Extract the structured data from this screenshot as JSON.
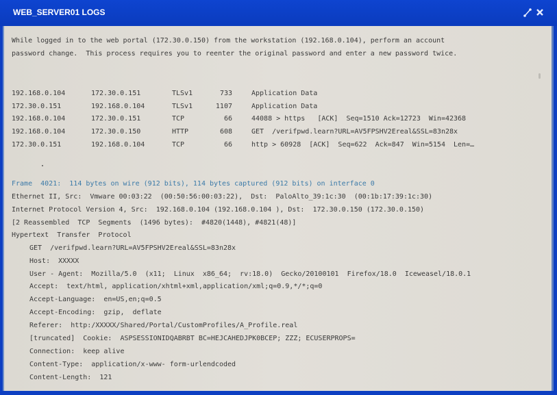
{
  "window": {
    "title": "WEB_SERVER01 LOGS",
    "resize_icon": "resize-icon",
    "close_icon": "close-icon"
  },
  "intro": {
    "line1": "While logged in to the web portal (172.30.0.150) from the workstation (192.168.0.104), perform an account",
    "line2": "password change.  This process requires you to reenter the original password and enter a new password twice."
  },
  "packets": [
    {
      "src": "192.168.0.104",
      "dst": "172.30.0.151",
      "proto": "TLSv1",
      "len": "733",
      "info": "Application Data"
    },
    {
      "src": "172.30.0.151",
      "dst": "192.168.0.104",
      "proto": "TLSv1",
      "len": "1107",
      "info": "Application Data"
    },
    {
      "src": "192.168.0.104",
      "dst": "172.30.0.151",
      "proto": "TCP",
      "len": "66",
      "info": "44088 > https   [ACK]  Seq=1510 Ack=12723  Win=42368"
    },
    {
      "src": "192.168.0.104",
      "dst": "172.30.0.150",
      "proto": "HTTP",
      "len": "608",
      "info": "GET  /verifpwd.learn?URL=AV5FPSHV2Ereal&SSL=83n28x"
    },
    {
      "src": "172.30.0.151",
      "dst": "192.168.0.104",
      "proto": "TCP",
      "len": "66",
      "info": "http > 60928  [ACK]  Seq=622  Ack=847  Win=5154  Len=…"
    }
  ],
  "details": {
    "frame": "Frame  4021:  114 bytes on wire (912 bits), 114 bytes captured (912 bits) on interface 0",
    "ethernet": "Ethernet II, Src:  Vmware 00:03:22  (00:50:56:00:03:22),  Dst:  PaloAlto_39:1c:30  (00:1b:17:39:1c:30)",
    "ip": "Internet Protocol Version 4, Src:  192.168.0.104 (192.168.0.104 ), Dst:  172.30.0.150 (172.30.0.150)",
    "reassembled": "[2 Reassembled  TCP  Segments  (1496 bytes):  #4820(1448), #4821(48)]",
    "http_header": "Hypertext  Transfer  Protocol",
    "http_lines": [
      "GET  /verifpwd.learn?URL=AV5FPSHV2Ereal&SSL=83n28x",
      "Host:  XXXXX",
      "User - Agent:  Mozilla/5.0  (x11;  Linux  x86_64;  rv:18.0)  Gecko/20100101  Firefox/18.0  Iceweasel/18.0.1",
      "Accept:  text/html, application/xhtml+xml,application/xml;q=0.9,*/*;q=0",
      "Accept-Language:  en=US,en;q=0.5",
      "Accept-Encoding:  gzip,  deflate",
      "Referer:  http:/XXXXX/Shared/Portal/CustomProfiles/A_Profile.real",
      "[truncated]  Cookie:  ASPSESSIONIDQABRBT BC=HEJCAHEDJPK0BCEP; ZZZ; ECUSERPROPS=",
      "Connection:  keep alive",
      "Content-Type:  application/x-www- form-urlendcoded",
      "Content-Length:  121"
    ]
  }
}
